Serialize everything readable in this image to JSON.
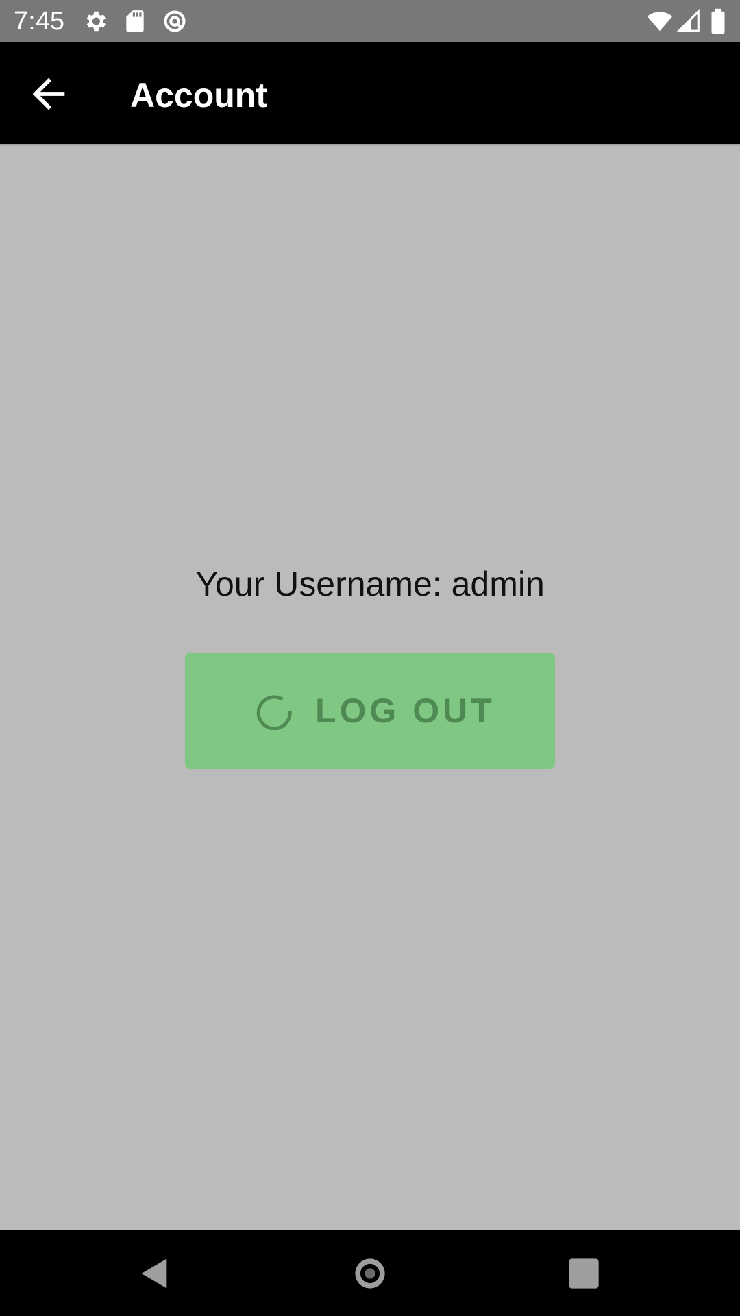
{
  "status_bar": {
    "time": "7:45",
    "icons_left": [
      "settings-gear-icon",
      "sd-card-icon",
      "data-saver-icon"
    ],
    "icons_right": [
      "wifi-icon",
      "cellular-signal-icon",
      "battery-icon"
    ]
  },
  "app_bar": {
    "back_icon": "arrow-back-icon",
    "title": "Account"
  },
  "main": {
    "username_text": "Your Username: admin",
    "logout_button": {
      "label": "LOG OUT",
      "state": "loading",
      "icon": "loading-spinner-icon"
    }
  },
  "nav_bar": {
    "buttons": [
      "back-triangle-icon",
      "home-circle-icon",
      "recents-square-icon"
    ]
  },
  "colors": {
    "status_bar_bg": "#787878",
    "app_bar_bg": "#000000",
    "scrim_bg": "#bbbbbb",
    "button_bg": "#81c784",
    "button_text": "#4e8a52"
  }
}
